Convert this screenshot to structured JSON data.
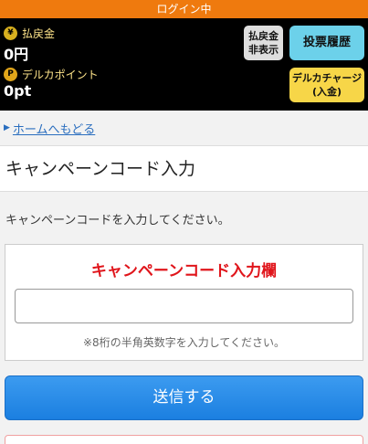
{
  "status_bar": {
    "text": "ログイン中"
  },
  "account": {
    "refund": {
      "icon": "yen-coin-icon",
      "label": "払戻金",
      "value": "0円"
    },
    "points": {
      "icon": "point-coin-icon",
      "label": "デルカポイント",
      "value": "0pt"
    },
    "hide_button": {
      "line1": "払戻金",
      "line2": "非表示"
    },
    "history_button": "投票履歴",
    "charge_button": {
      "line1": "デルカチャージ",
      "line2": "(入金)"
    }
  },
  "breadcrumb": {
    "link": "ホームへもどる"
  },
  "page": {
    "title": "キャンペーンコード入力",
    "description": "キャンペーンコードを入力してください。"
  },
  "form": {
    "title": "キャンペーンコード入力欄",
    "input_value": "",
    "note": "※8桁の半角英数字を入力してください。",
    "submit": "送信する"
  },
  "colors": {
    "status_bar": "#ef7a0e",
    "history_button": "#6cd1ea",
    "charge_button": "#f7d648",
    "form_title": "#e0151b",
    "submit": "#1b7fe0",
    "link": "#2a6ebf"
  }
}
